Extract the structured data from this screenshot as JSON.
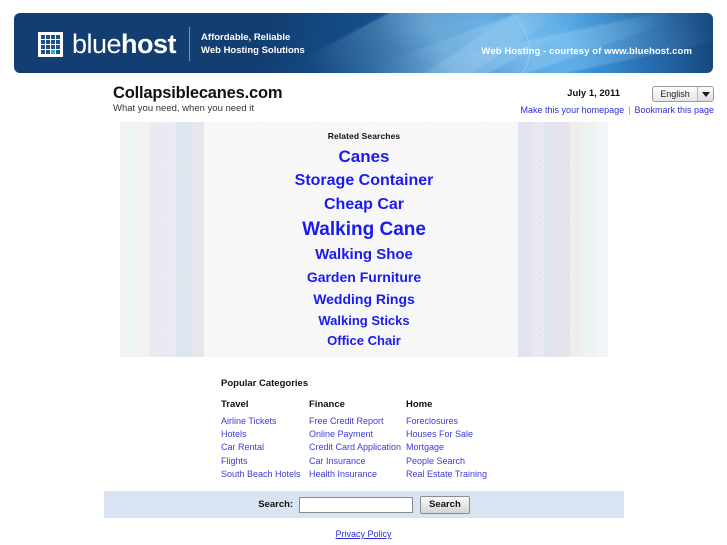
{
  "banner": {
    "logo_name": "bluehost",
    "logo_light": "blue",
    "logo_bold": "host",
    "tagline_line1": "Affordable, Reliable",
    "tagline_line2": "Web Hosting Solutions",
    "courtesy": "Web Hosting - courtesy of www.bluehost.com",
    "accent_color": "#27b7bf",
    "banner_color": "#123e72"
  },
  "site": {
    "title": "Collapsiblecanes.com",
    "subtitle": "What you need, when you need it",
    "date": "July 1, 2011",
    "language": "English",
    "make_homepage": "Make this your homepage",
    "bookmark": "Bookmark this page"
  },
  "related": {
    "heading": "Related Searches",
    "link_color": "#1b1bf0",
    "items": [
      {
        "label": "Canes",
        "size": 17,
        "gap": 7
      },
      {
        "label": "Storage Container",
        "size": 16,
        "gap": 7
      },
      {
        "label": "Cheap Car",
        "size": 16,
        "gap": 7
      },
      {
        "label": "Walking Cane",
        "size": 19,
        "gap": 7
      },
      {
        "label": "Walking Shoe",
        "size": 15,
        "gap": 7
      },
      {
        "label": "Garden Furniture",
        "size": 14,
        "gap": 7
      },
      {
        "label": "Wedding Rings",
        "size": 14,
        "gap": 7
      },
      {
        "label": "Walking Sticks",
        "size": 13,
        "gap": 7
      },
      {
        "label": "Office Chair",
        "size": 13,
        "gap": 7
      }
    ]
  },
  "categories": {
    "heading": "Popular Categories",
    "columns": [
      {
        "header": "Travel",
        "links": [
          "Airline Tickets",
          "Hotels",
          "Car Rental",
          "Flights",
          "South Beach Hotels"
        ]
      },
      {
        "header": "Finance",
        "links": [
          "Free Credit Report",
          "Online Payment",
          "Credit Card Application",
          "Car Insurance",
          "Health Insurance"
        ]
      },
      {
        "header": "Home",
        "links": [
          "Foreclosures",
          "Houses For Sale",
          "Mortgage",
          "People Search",
          "Real Estate Training"
        ]
      }
    ]
  },
  "search": {
    "label": "Search:",
    "value": "",
    "placeholder": "",
    "button": "Search",
    "bar_color": "#d9e4f2"
  },
  "footer": {
    "privacy": "Privacy Policy"
  }
}
